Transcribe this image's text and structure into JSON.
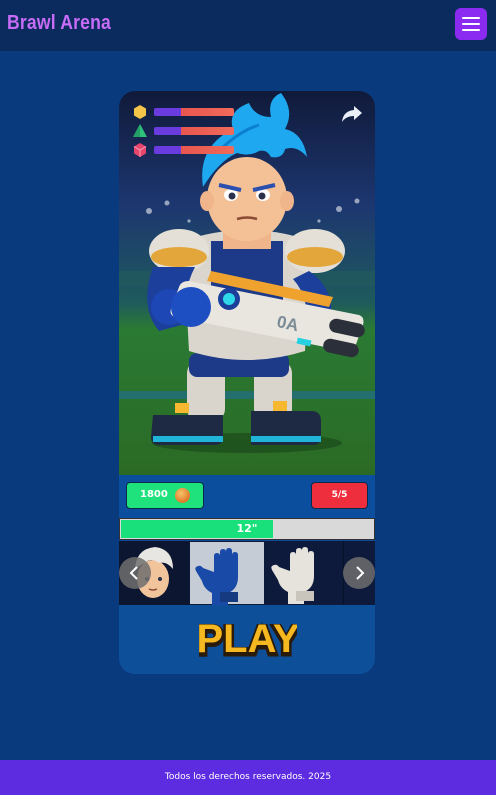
{
  "header": {
    "brand": "Brawl Arena",
    "menu_icon": "hamburger-menu-icon"
  },
  "character_card": {
    "stats": [
      {
        "icon": "gold-hexagon-icon",
        "color": "#f5c54a",
        "value_fraction": 0.34
      },
      {
        "icon": "green-pyramid-icon",
        "color": "#2ec27a",
        "value_fraction": 0.34
      },
      {
        "icon": "pink-cube-icon",
        "color": "#e8456d",
        "value_fraction": 0.34
      }
    ],
    "share_icon": "share-arrow-icon",
    "coins": "1800",
    "coin_icon": "coin-icon",
    "lives": "5/5",
    "progress_label": "12\"",
    "progress_fraction": 0.6,
    "carousel": {
      "items": [
        {
          "name": "avatar-character",
          "selected": false
        },
        {
          "name": "blue-glove",
          "selected": true
        },
        {
          "name": "white-glove",
          "selected": false
        }
      ],
      "prev_icon": "chevron-left-icon",
      "next_icon": "chevron-right-icon"
    },
    "play_label": "PLAY"
  },
  "footer": {
    "text": "Todos los derechos reservados. 2025"
  },
  "colors": {
    "background": "#0a3a7e",
    "header": "#0b2b5e",
    "accent": "#8b2bf2",
    "coins_badge": "#1fe27c",
    "lives_badge": "#ee2e3c",
    "footer": "#5e2ce0",
    "play_text": "#f6b820"
  }
}
